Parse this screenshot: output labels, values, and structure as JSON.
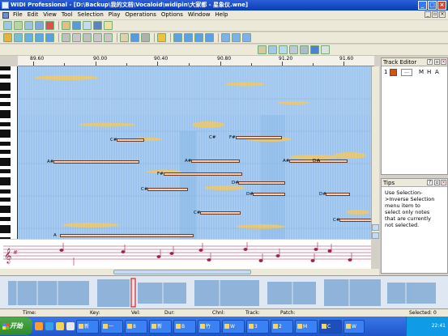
{
  "window": {
    "title": "WIDI Professional - [D:\\Backup\\我的文档\\Vocaloid\\widipin\\大家都 - 星象仪.wne]"
  },
  "menu": [
    "File",
    "Edit",
    "View",
    "Tool",
    "Selection",
    "Play",
    "Operations",
    "Options",
    "Window",
    "Help"
  ],
  "ruler": {
    "ticks": [
      "89.60",
      "90.00",
      "90.40",
      "90.80",
      "91.20",
      "91.60"
    ]
  },
  "notes": [
    {
      "label": "C#"
    },
    {
      "label": "A#"
    },
    {
      "label": "F#"
    },
    {
      "label": "C#"
    },
    {
      "label": "F#"
    },
    {
      "label": "A#"
    },
    {
      "label": "A#"
    },
    {
      "label": "D#"
    },
    {
      "label": "D#"
    },
    {
      "label": "C#"
    },
    {
      "label": "D#"
    },
    {
      "label": "D#"
    },
    {
      "label": "C#"
    },
    {
      "label": "C#"
    },
    {
      "label": "A"
    }
  ],
  "track_editor": {
    "title": "Track Editor",
    "row_number": "1",
    "row_text": "...",
    "m": "M",
    "h": "H",
    "a": "A",
    "color": "#c8541e"
  },
  "tips": {
    "title": "Tips",
    "text": "Use Selection->Inverse Selection menu item to select only notes that are currently not selected."
  },
  "status": {
    "time": "Time:",
    "key": "Key:",
    "vel": "Vel:",
    "dur": "Dur:",
    "chnl": "Chnl:",
    "track": "Track:",
    "patch": "Patch:",
    "selected": "Selected: 0"
  },
  "taskbar": {
    "start": "开始",
    "tasks": [
      "新",
      "一",
      "8",
      "新",
      "B",
      "竹",
      "W",
      "3",
      "2",
      "M",
      "C",
      "W"
    ],
    "clock": "22:41"
  }
}
